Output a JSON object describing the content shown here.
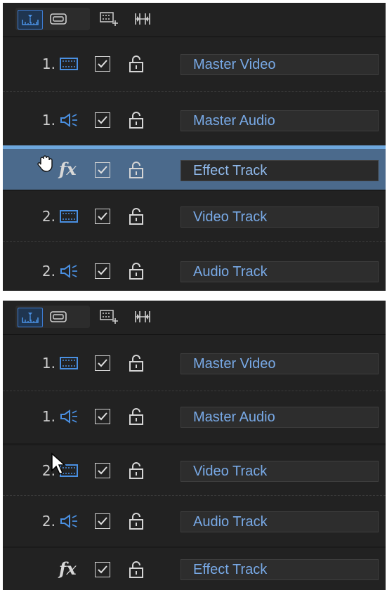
{
  "toolbar": {
    "buttons": [
      {
        "name": "timeline-view",
        "icon": "timeline-ruler-icon",
        "active": true
      },
      {
        "name": "storyboard-view",
        "icon": "storyboard-icon",
        "active": false
      },
      {
        "name": "track-manager",
        "icon": "add-track-icon",
        "active": false
      },
      {
        "name": "fit-timeline",
        "icon": "fit-timeline-icon",
        "active": false
      }
    ]
  },
  "top_panel": {
    "tracks": [
      {
        "index": "1.",
        "type": "video",
        "label": "Master Video"
      },
      {
        "index": "1.",
        "type": "audio",
        "label": "Master Audio"
      },
      {
        "index": "",
        "type": "effect",
        "label": "Effect Track",
        "selected": true
      },
      {
        "index": "2.",
        "type": "video",
        "label": "Video Track"
      },
      {
        "index": "2.",
        "type": "audio",
        "label": "Audio Track"
      }
    ]
  },
  "bottom_panel": {
    "tracks": [
      {
        "index": "1.",
        "type": "video",
        "label": "Master Video"
      },
      {
        "index": "1.",
        "type": "audio",
        "label": "Master Audio"
      },
      {
        "index": "2.",
        "type": "video",
        "label": "Video Track"
      },
      {
        "index": "2.",
        "type": "audio",
        "label": "Audio Track"
      },
      {
        "index": "",
        "type": "effect",
        "label": "Effect Track"
      }
    ]
  },
  "effect_glyph": "fx",
  "colors": {
    "accent": "#3d7bd0",
    "label_text": "#78a9e6",
    "selected_row": "#4b6a8c",
    "drop_indicator": "#6ea7dd",
    "panel_bg": "#222222"
  }
}
